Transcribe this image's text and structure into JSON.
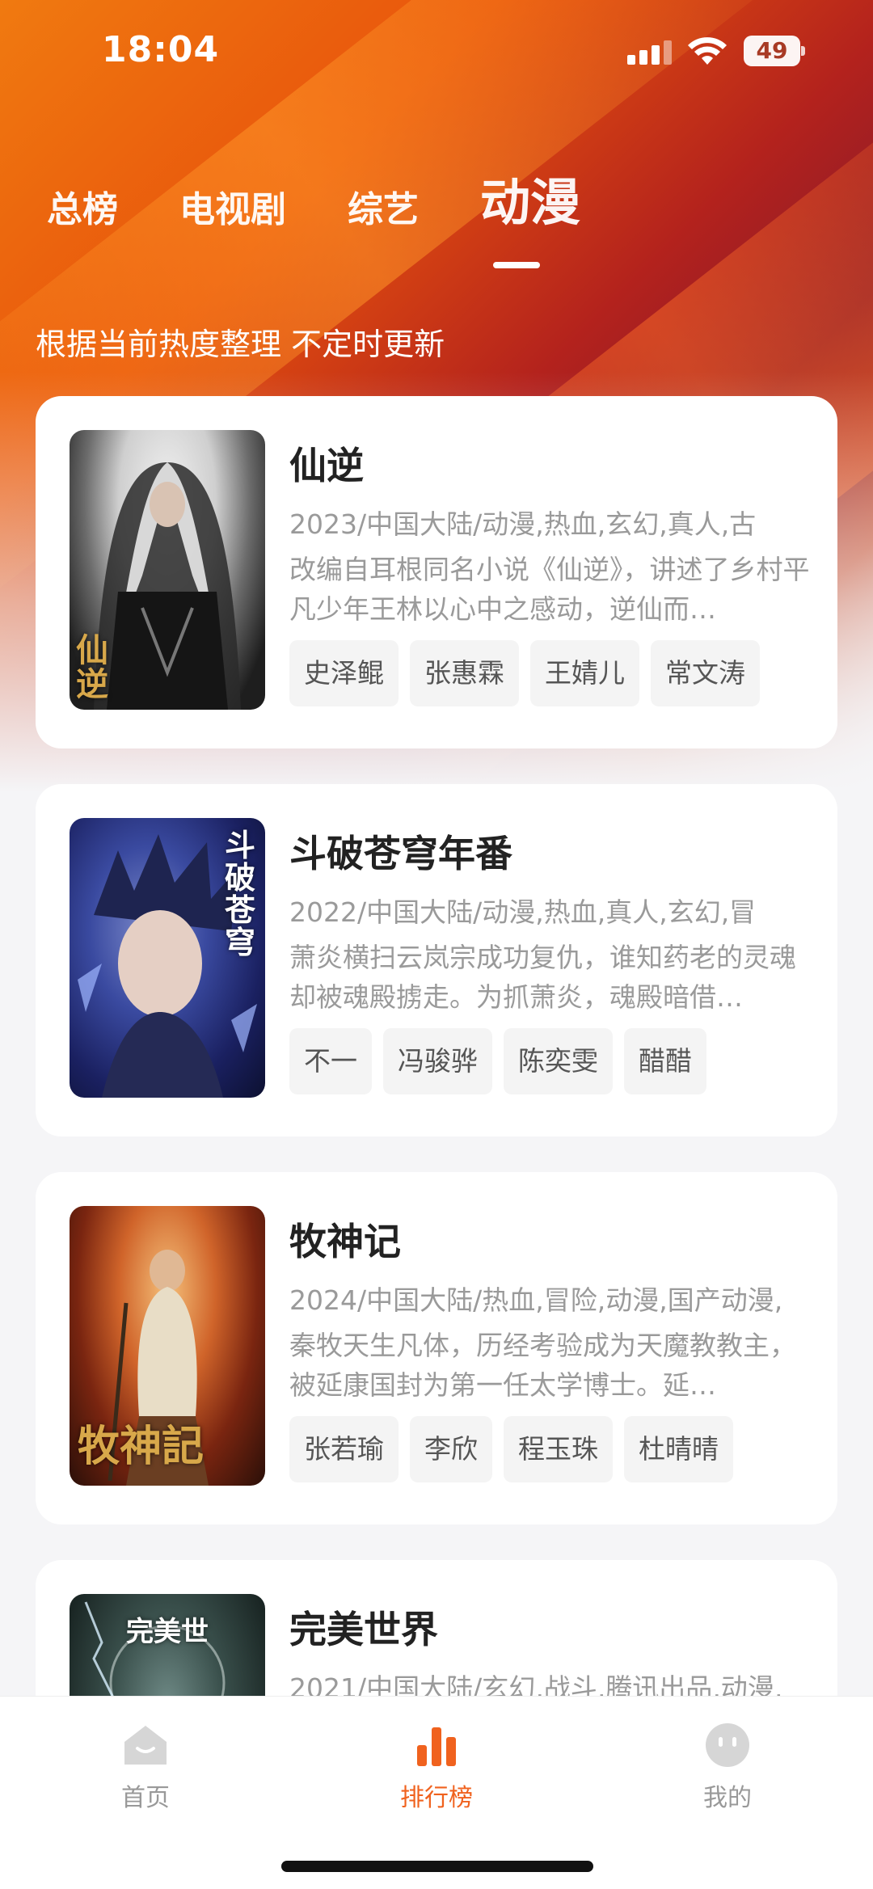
{
  "status_bar": {
    "time": "18:04",
    "battery": "49"
  },
  "tabs": [
    {
      "label": "总榜",
      "active": false
    },
    {
      "label": "电视剧",
      "active": false
    },
    {
      "label": "综艺",
      "active": false
    },
    {
      "label": "动漫",
      "active": true
    }
  ],
  "subtitle": "根据当前热度整理 不定时更新",
  "cards": [
    {
      "title": "仙逆",
      "meta": "2023/中国大陆/动漫,热血,玄幻,真人,古",
      "desc": "改编自耳根同名小说《仙逆》，讲述了乡村平凡少年王林以心中之感动，逆仙而…",
      "tags": [
        "史泽鲲",
        "张惠霖",
        "王婧儿",
        "常文涛"
      ],
      "poster_caption": "仙逆"
    },
    {
      "title": "斗破苍穹年番",
      "meta": "2022/中国大陆/动漫,热血,真人,玄幻,冒",
      "desc": "萧炎横扫云岚宗成功复仇，谁知药老的灵魂却被魂殿掳走。为抓萧炎，魂殿暗借…",
      "tags": [
        "不一",
        "冯骏骅",
        "陈奕雯",
        "醋醋"
      ],
      "poster_caption": "斗破苍穹"
    },
    {
      "title": "牧神记",
      "meta": "2024/中国大陆/热血,冒险,动漫,国产动漫,",
      "desc": "秦牧天生凡体，历经考验成为天魔教教主，被延康国封为第一任太学博士。延…",
      "tags": [
        "张若瑜",
        "李欣",
        "程玉珠",
        "杜晴晴"
      ],
      "poster_caption": "牧神記"
    },
    {
      "title": "完美世界",
      "meta": "2021/中国大陆/玄幻,战斗,腾讯出品,动漫,",
      "desc": "",
      "tags": [],
      "poster_caption": "完美世"
    }
  ],
  "bottom_nav": [
    {
      "label": "首页",
      "icon": "home-icon",
      "active": false
    },
    {
      "label": "排行榜",
      "icon": "ranking-chart-icon",
      "active": true
    },
    {
      "label": "我的",
      "icon": "profile-face-icon",
      "active": false
    }
  ],
  "colors": {
    "accent": "#f0621e",
    "hero_orange": "#f07a10",
    "hero_red": "#b3221d"
  }
}
